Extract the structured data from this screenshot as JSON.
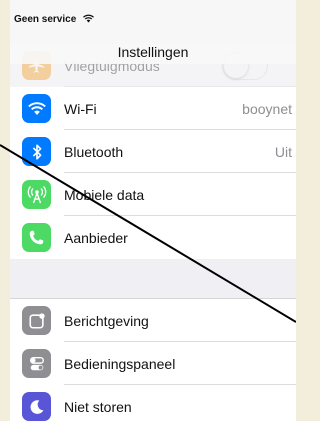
{
  "status_bar": {
    "carrier": "Geen service",
    "wifi_icon": "wifi-icon"
  },
  "nav": {
    "title": "Instellingen"
  },
  "rows_group1": [
    {
      "name": "airplane-mode",
      "label": "Vliegtuigmodus",
      "value": "",
      "icon": "airplane-icon",
      "color": "#ff9500",
      "toggle": true
    },
    {
      "name": "wifi",
      "label": "Wi-Fi",
      "value": "booynet",
      "icon": "wifi-icon",
      "color": "#007aff"
    },
    {
      "name": "bluetooth",
      "label": "Bluetooth",
      "value": "Uit",
      "icon": "bluetooth-icon",
      "color": "#007aff"
    },
    {
      "name": "mobile-data",
      "label": "Mobiele data",
      "value": "",
      "icon": "antenna-icon",
      "color": "#4cd964"
    },
    {
      "name": "carrier",
      "label": "Aanbieder",
      "value": "",
      "icon": "phone-icon",
      "color": "#4cd964"
    }
  ],
  "rows_group2": [
    {
      "name": "notifications",
      "label": "Berichtgeving",
      "value": "",
      "icon": "notifications-icon",
      "color": "#8e8e93"
    },
    {
      "name": "control-center",
      "label": "Bedieningspaneel",
      "value": "",
      "icon": "control-center-icon",
      "color": "#8e8e93"
    },
    {
      "name": "do-not-disturb",
      "label": "Niet storen",
      "value": "",
      "icon": "moon-icon",
      "color": "#5856d6"
    }
  ]
}
